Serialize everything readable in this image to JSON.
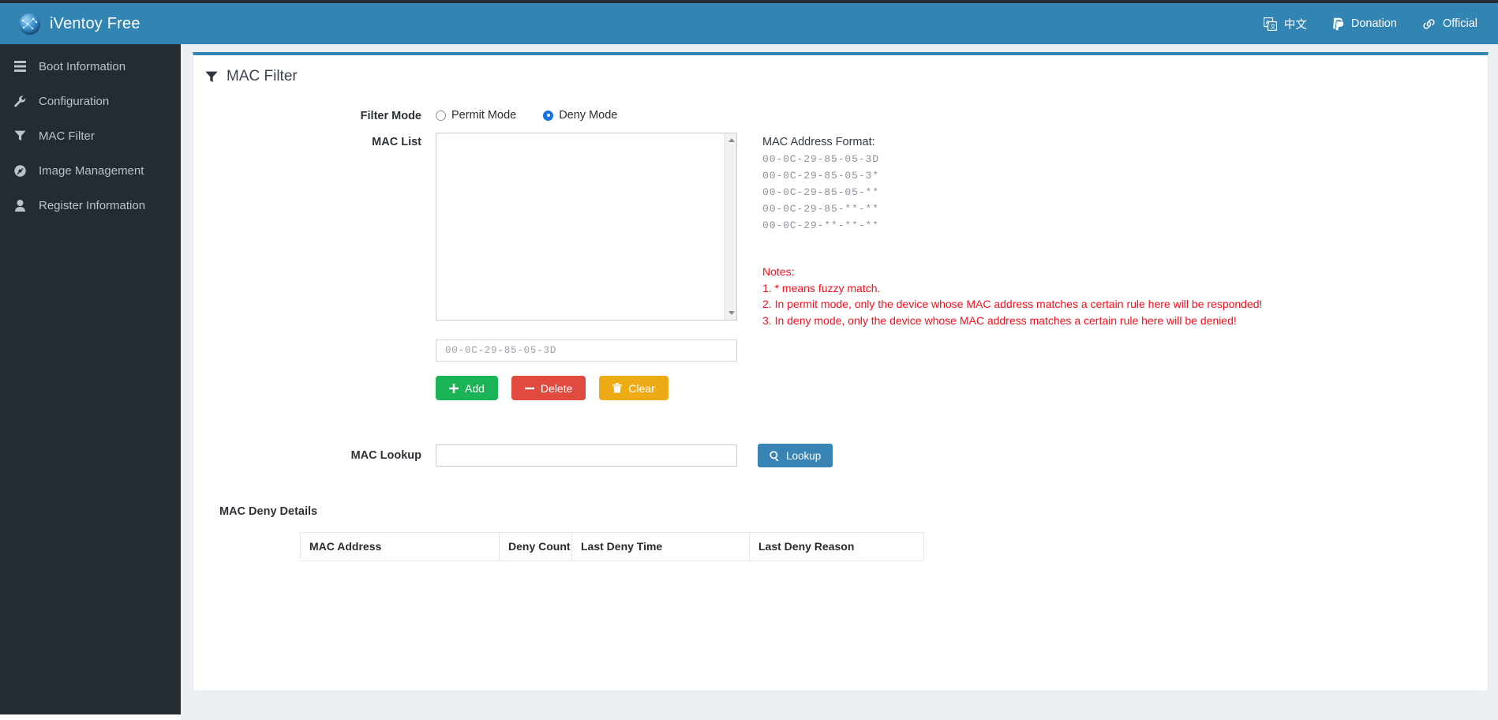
{
  "header": {
    "brand": "iVentoy Free",
    "logo_icon": "globe-network-icon",
    "bg_color": "#3284b3",
    "right_items": [
      {
        "label": "中文",
        "icon": "translate-icon"
      },
      {
        "label": "Donation",
        "icon": "paypal-icon"
      },
      {
        "label": "Official",
        "icon": "link-icon"
      }
    ]
  },
  "sidebar": {
    "bg_color": "#242b31",
    "items": [
      {
        "label": "Boot Information",
        "icon": "server-list-icon"
      },
      {
        "label": "Configuration",
        "icon": "wrench-icon"
      },
      {
        "label": "MAC Filter",
        "icon": "funnel-icon"
      },
      {
        "label": "Image Management",
        "icon": "disc-icon"
      },
      {
        "label": "Register Information",
        "icon": "user-icon"
      }
    ]
  },
  "panel": {
    "title": "MAC Filter",
    "title_icon": "funnel-icon",
    "accent_color": "#3284b3"
  },
  "form": {
    "filter_mode": {
      "label": "Filter Mode",
      "options": [
        {
          "label": "Permit Mode",
          "selected": false
        },
        {
          "label": "Deny Mode",
          "selected": true
        }
      ]
    },
    "mac_list": {
      "label": "MAC List",
      "value": "",
      "scrollbar": true
    },
    "mac_input": {
      "value": "",
      "placeholder": "00-0C-29-85-05-3D"
    },
    "buttons": [
      {
        "label": "Add",
        "icon": "plus-icon",
        "color": "#1ab356"
      },
      {
        "label": "Delete",
        "icon": "minus-icon",
        "color": "#e04a3f"
      },
      {
        "label": "Clear",
        "icon": "trash-icon",
        "color": "#edab16"
      }
    ],
    "mac_lookup": {
      "label": "MAC Lookup",
      "value": "",
      "placeholder": "",
      "button_label": "Lookup",
      "button_icon": "search-icon",
      "button_color": "#3784b5"
    }
  },
  "format_help": {
    "title": "MAC Address Format:",
    "examples": [
      "00-0C-29-85-05-3D",
      "00-0C-29-85-05-3*",
      "00-0C-29-85-05-**",
      "00-0C-29-85-**-**",
      "00-0C-29-**-**-**"
    ],
    "notes_title": "Notes:",
    "notes_color": "#fc0d1b",
    "notes": [
      "1. * means fuzzy match.",
      "2. In permit mode, only the device whose MAC address matches a certain rule here will be responded!",
      "3. In deny mode, only the device whose MAC address matches a certain rule here will be denied!"
    ]
  },
  "deny_details": {
    "title": "MAC Deny Details",
    "columns": [
      "MAC Address",
      "Deny Count",
      "Last Deny Time",
      "Last Deny Reason"
    ],
    "rows": []
  }
}
